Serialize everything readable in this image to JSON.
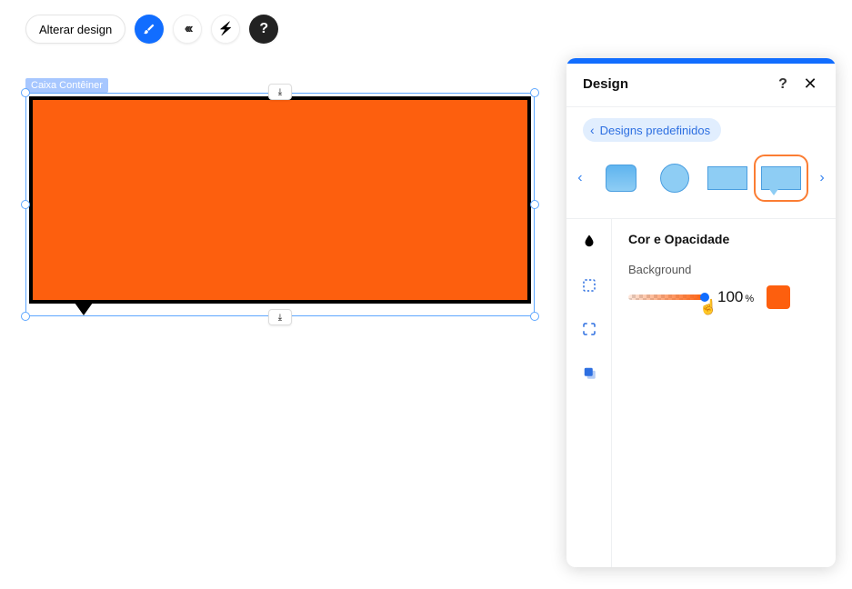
{
  "toolbar": {
    "change_design_label": "Alterar design"
  },
  "canvas": {
    "element_label": "Caixa Contêiner",
    "fill_color": "#fd5f0e"
  },
  "panel": {
    "title": "Design",
    "preset_pill": "Designs predefinidos",
    "section_title": "Cor e Opacidade",
    "background_label": "Background",
    "opacity_value": "100",
    "opacity_unit": "%",
    "swatch_color": "#fd5f0e"
  }
}
